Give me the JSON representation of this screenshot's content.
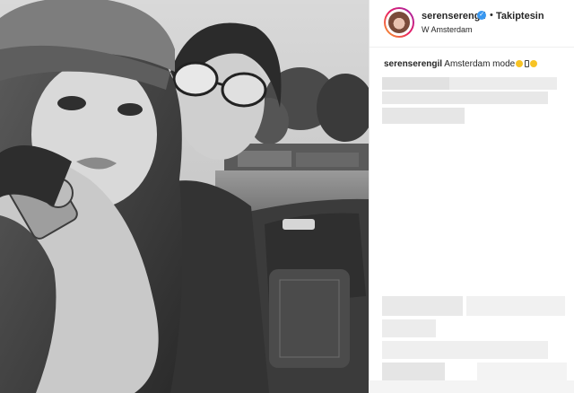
{
  "post": {
    "photo": {
      "description_icon": "photo",
      "pillow_logo_icon": "brand-logo-icon"
    }
  },
  "header": {
    "username": "serenserengil",
    "verified_icon": "verified-badge-icon",
    "separator": "•",
    "follow_state": "Takiptesin",
    "location": "W Amsterdam"
  },
  "caption": {
    "username": "serenserengil",
    "text": "Amsterdam mode"
  },
  "colors": {
    "verified": "#3897f0",
    "text": "#262626",
    "placeholder": "#e4e4e4"
  }
}
